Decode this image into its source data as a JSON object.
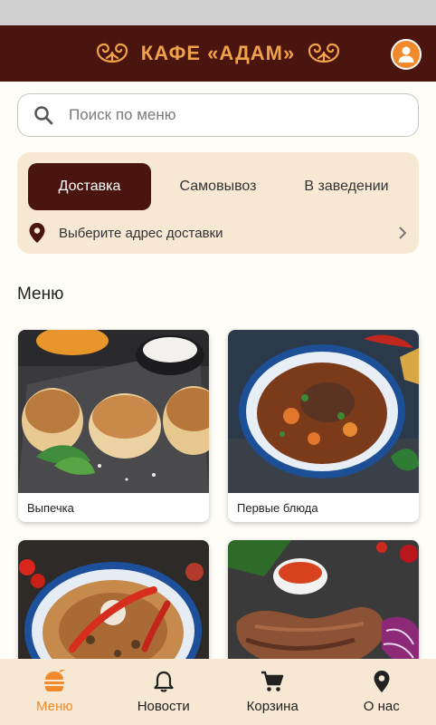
{
  "header": {
    "title": "КАФЕ «АДАМ»"
  },
  "search": {
    "placeholder": "Поиск по меню"
  },
  "delivery": {
    "tabs": [
      {
        "label": "Доставка",
        "active": true
      },
      {
        "label": "Самовывоз",
        "active": false
      },
      {
        "label": "В заведении",
        "active": false
      }
    ],
    "address_prompt": "Выберите адрес доставки"
  },
  "menu": {
    "title": "Меню",
    "categories": [
      {
        "label": "Выпечка"
      },
      {
        "label": "Первые блюда"
      },
      {
        "label": ""
      },
      {
        "label": ""
      }
    ]
  },
  "bottom_nav": {
    "items": [
      {
        "label": "Меню",
        "icon": "burger-icon",
        "active": true
      },
      {
        "label": "Новости",
        "icon": "bell-icon",
        "active": false
      },
      {
        "label": "Корзина",
        "icon": "cart-icon",
        "active": false
      },
      {
        "label": "О нас",
        "icon": "location-pin-icon",
        "active": false
      }
    ]
  },
  "colors": {
    "primary": "#4a140f",
    "accent": "#f08a2c",
    "panel": "#f7e8d4"
  }
}
